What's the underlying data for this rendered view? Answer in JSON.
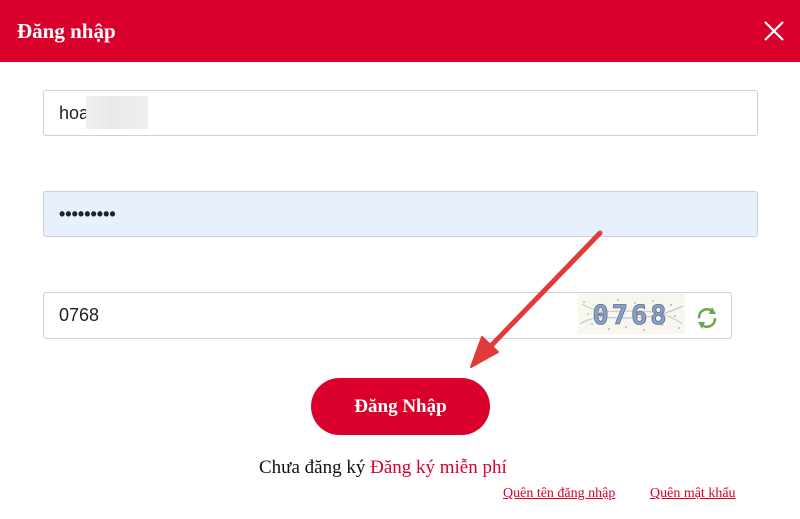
{
  "dialog": {
    "title": "Đăng nhập"
  },
  "form": {
    "username_value": "hoa      n1112",
    "password_value": "•••••••••",
    "captcha_value": "0768",
    "captcha_image_text": "0768",
    "login_label": "Đăng Nhập"
  },
  "footer": {
    "signup_prefix": "Chưa đăng ký",
    "signup_link": "Đăng ký miễn phí",
    "forgot_username": "Quên tên đăng nhập",
    "forgot_password": "Quên mật khẩu"
  },
  "icons": {
    "close": "close-icon",
    "refresh": "refresh-icon",
    "arrow": "arrow-annotation"
  },
  "colors": {
    "brand": "#d9002b",
    "autofill": "#e8f0fe",
    "refresh": "#6aa84f"
  }
}
